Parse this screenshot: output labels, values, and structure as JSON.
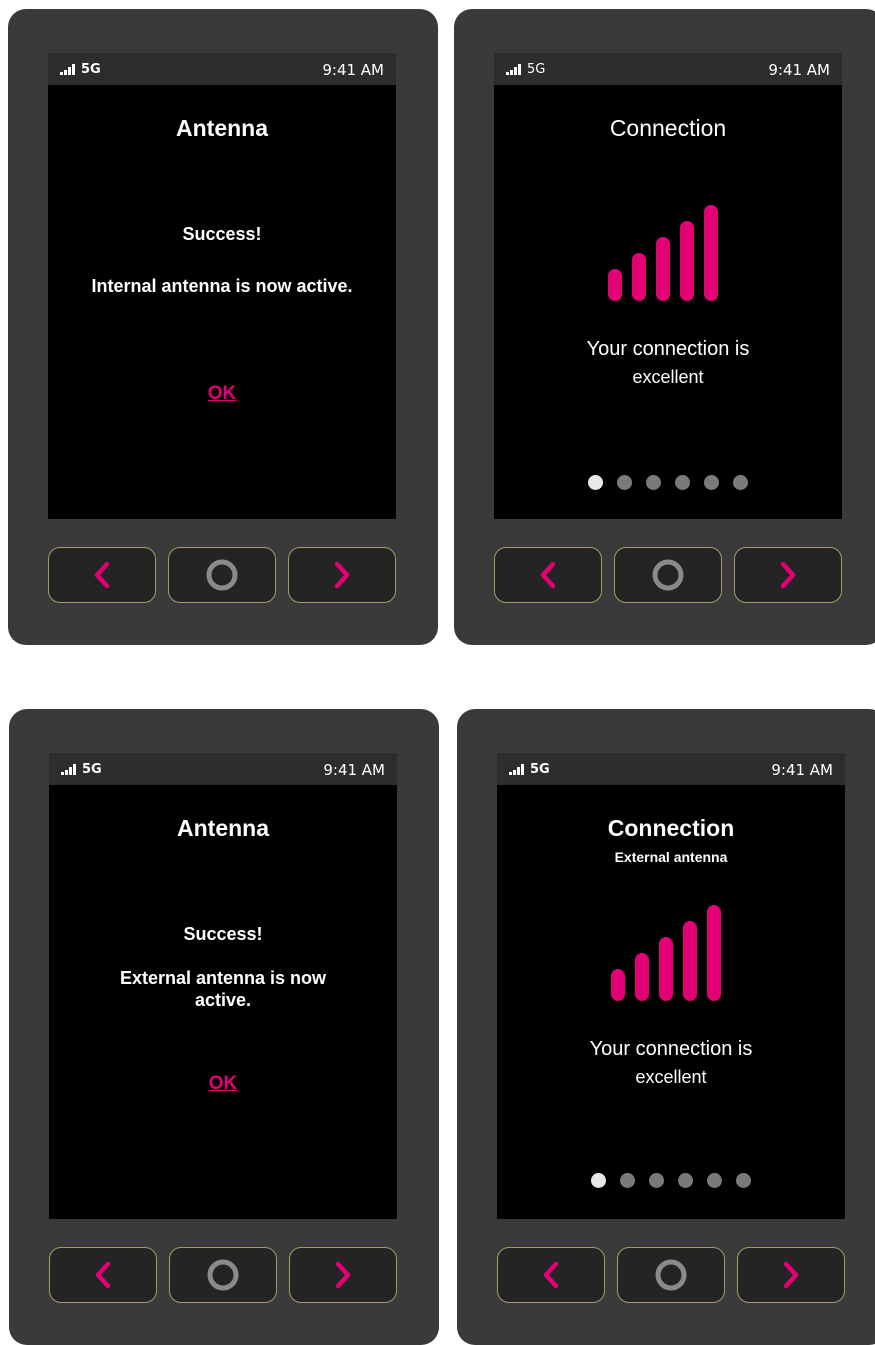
{
  "colors": {
    "accent": "#e20074",
    "device": "#3a3a3a",
    "screen": "#000000",
    "button_border": "#a89a6a"
  },
  "status": {
    "signal_label": "5G",
    "time": "9:41 AM"
  },
  "screens": [
    {
      "title": "Antenna",
      "success": "Success!",
      "message": "Internal antenna is now active.",
      "ok_label": "OK"
    },
    {
      "title": "Connection",
      "signal_bars": 5,
      "description_line1": "Your connection is",
      "description_line2": "excellent",
      "page_dots": 6,
      "active_page": 1
    },
    {
      "title": "Antenna",
      "success": "Success!",
      "message_line1": "External antenna is now",
      "message_line2": "active.",
      "ok_label": "OK"
    },
    {
      "title": "Connection",
      "subtitle": "External antenna",
      "signal_bars": 5,
      "description_line1": "Your connection is",
      "description_line2": "excellent",
      "page_dots": 6,
      "active_page": 1
    }
  ],
  "hardware_buttons": {
    "back_icon": "chevron-left-icon",
    "home_icon": "circle-home-icon",
    "next_icon": "chevron-right-icon"
  }
}
